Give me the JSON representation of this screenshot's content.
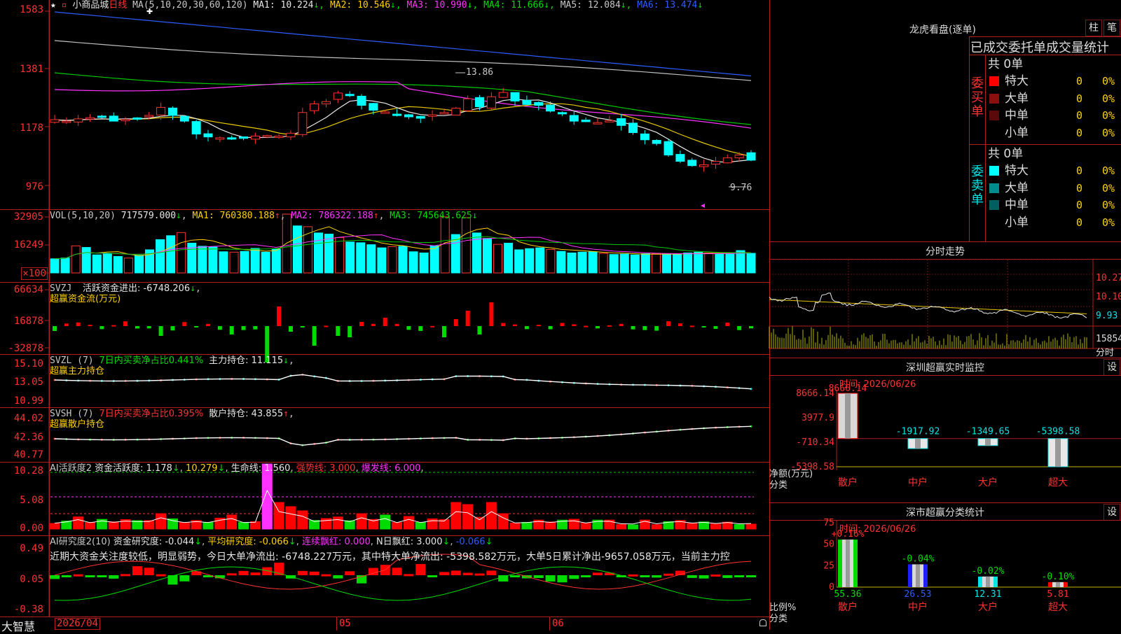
{
  "header": {
    "star_glyph": "★",
    "square_glyph": "▫",
    "stock_name": "小商品城",
    "period": "日线",
    "ma_title": "MA(5,10,20,30,60,120)",
    "ma_items": [
      {
        "label": "MA1: 10.224",
        "arrow": "↓",
        "color": "#e6e6e6"
      },
      {
        "label": "MA2: 10.546",
        "arrow": "↓",
        "color": "#ffd200"
      },
      {
        "label": "MA3: 10.990",
        "arrow": "↓",
        "color": "#ff32ff"
      },
      {
        "label": "MA4: 11.666",
        "arrow": "↓",
        "color": "#00dc00"
      },
      {
        "label": "MA5: 12.084",
        "arrow": "↓",
        "color": "#c8c8c8"
      },
      {
        "label": "MA6: 13.474",
        "arrow": "↓",
        "color": "#2e5cff"
      }
    ],
    "cross_glyph": "✚"
  },
  "price_axis": [
    "1583",
    "1381",
    "1178",
    "976"
  ],
  "price_marks": {
    "high": "13.86",
    "low": "9.76"
  },
  "vol": {
    "title": "VOL(5,10,20)",
    "value": "717579.000",
    "ma1": "MA1: 760380.188",
    "ma2": "MA2: 786322.188",
    "ma3": "MA3: 745643.625",
    "axis": [
      "32905",
      "16249",
      "×100"
    ],
    "data": [
      0.72,
      0.76,
      1.38,
      1.3,
      0.92,
      0.98,
      0.84,
      0.76,
      0.9,
      1.18,
      1.7,
      1.9,
      2.06,
      1.52,
      1.36,
      1.32,
      1.08,
      1.06,
      1.1,
      1.25,
      1.06,
      1.22,
      3.0,
      2.4,
      2.36,
      2.04,
      1.98,
      1.8,
      1.58,
      1.54,
      1.44,
      1.28,
      1.34,
      1.36,
      1.08,
      1.02,
      1.38,
      2.86,
      1.96,
      2.82,
      2.04,
      1.76,
      1.46,
      1.52,
      1.18,
      1.24,
      1.28,
      1.2,
      1.1,
      1.02,
      1.06,
      1.08,
      1.0,
      0.94,
      0.96,
      0.92,
      0.98,
      0.98,
      0.96,
      0.96,
      1.02,
      1.06,
      1.02,
      1.0,
      0.96,
      1.14,
      1.0
    ]
  },
  "svzj": {
    "title": "SVZJ",
    "label": "活跃资金进出: -6748.206",
    "sub": "超赢资金流(万元)",
    "axis": [
      "66634",
      "16878",
      "-32878"
    ]
  },
  "svzl": {
    "title": "SVZL (7)",
    "label1": "7日内买卖净占比0.441%",
    "label2": "主力持仓: 11.115",
    "sub": "超赢主力持仓",
    "axis": [
      "15.10",
      "13.05",
      "10.99"
    ]
  },
  "svsh": {
    "title": "SVSH (7)",
    "label1": "7日内买卖净占比0.395%",
    "label2": "散户持仓: 43.855",
    "sub": "超赢散户持仓",
    "axis": [
      "44.02",
      "42.36",
      "40.77"
    ]
  },
  "ai_active": {
    "title": "AI活跃度2",
    "label1": "资金活跃度: 1.178",
    "label2": "10.279",
    "label3": "生命线: 1.560",
    "label4": "强势线: 3.000",
    "label5": "爆发线: 6.000",
    "axis": [
      "10.28",
      "5.08",
      "0.00"
    ]
  },
  "ai_research": {
    "title": "AI研究度2(10)",
    "label1": "资金研究度: -0.044",
    "label2": "平均研究度: -0.066",
    "label3": "连续飘红: 0.000",
    "label4": "N日飘红: 3.000",
    "label5": "-0.066",
    "message": "近期大资金关注度较低，明显弱势，今日大单净流出: -6748.227万元，其中特大单净流出: -5398.582万元，大单5日累计净出-9657.058万元，当前主力控",
    "axis": [
      "0.49",
      "0.05",
      "-0.38"
    ]
  },
  "footer": {
    "brand": "大智慧",
    "date": "2026/04",
    "month1": "05",
    "month2": "06"
  },
  "dragon": {
    "title": "龙虎看盘(逐单)",
    "btn1": "柱",
    "btn2": "笔",
    "subtitle": "已成交委托单成交量统计",
    "buy": {
      "side": "委买单",
      "total": "共 0单",
      "rows": [
        {
          "color": "#ff0000",
          "name": "特大",
          "count": "0",
          "pct": "0%"
        },
        {
          "color": "#8a1010",
          "name": "大单",
          "count": "0",
          "pct": "0%"
        },
        {
          "color": "#5a0a0a",
          "name": "中单",
          "count": "0",
          "pct": "0%"
        },
        {
          "color": "#000000",
          "name": "小单",
          "count": "0",
          "pct": "0%"
        }
      ]
    },
    "sell": {
      "side": "委卖单",
      "total": "共 0单",
      "rows": [
        {
          "color": "#00ffff",
          "name": "特大",
          "count": "0",
          "pct": "0%"
        },
        {
          "color": "#008c8c",
          "name": "大单",
          "count": "0",
          "pct": "0%"
        },
        {
          "color": "#006060",
          "name": "中单",
          "count": "0",
          "pct": "0%"
        },
        {
          "color": "#000000",
          "name": "小单",
          "count": "0",
          "pct": "0%"
        }
      ]
    }
  },
  "intraday": {
    "title": "分时走势",
    "axis": [
      "10.27",
      "10.10",
      "9.93"
    ],
    "vol_label": "15854",
    "time_label": "分时"
  },
  "monitor": {
    "title": "深圳超赢实时监控",
    "settings": "设",
    "time": "时间: 2026/06/26",
    "axis": [
      "8666.14",
      "3977.9",
      "-710.34",
      "-5398.58"
    ],
    "ylabel": "净额(万元)",
    "xlabel": "分类",
    "categories": [
      "散户",
      "中户",
      "大户",
      "超大"
    ],
    "values": [
      8666.14,
      -1917.92,
      -1349.65,
      -5398.58
    ],
    "value_labels": [
      "8666.14",
      "-1917.92",
      "-1349.65",
      "-5398.58"
    ]
  },
  "classify": {
    "title": "深市超赢分类统计",
    "settings": "设",
    "time": "时间: 2026/06/26",
    "axis": [
      "75",
      "50",
      "25",
      "0"
    ],
    "ylabel": "比例%",
    "xlabel": "分类",
    "categories": [
      "散户",
      "中户",
      "大户",
      "超大"
    ],
    "values": [
      55.36,
      26.53,
      12.31,
      5.81
    ],
    "value_labels": [
      "55.36",
      "26.53",
      "12.31",
      "5.81"
    ],
    "changes": [
      "+0.16%",
      "-0.04%",
      "-0.02%",
      "-0.10%"
    ]
  }
}
